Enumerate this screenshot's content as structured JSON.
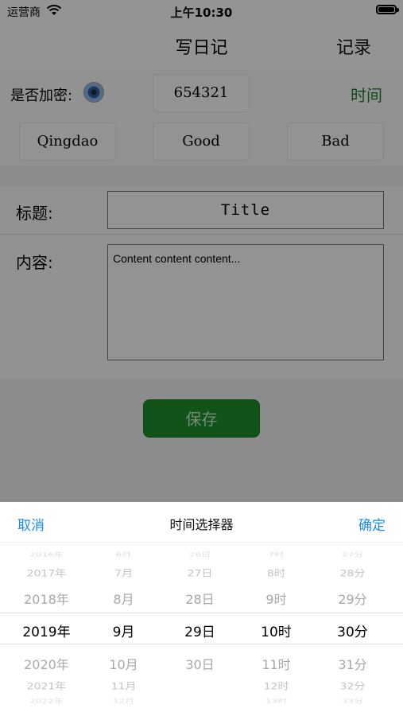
{
  "status": {
    "carrier": "运营商",
    "time": "上午10:30"
  },
  "nav": {
    "title": "写日记",
    "right_button": "记录"
  },
  "form": {
    "encrypt_label": "是否加密:",
    "password_value": "654321",
    "time_button": "时间",
    "options": [
      "Qingdao",
      "Good",
      "Bad"
    ],
    "title_label": "标题:",
    "title_value": "Title",
    "content_label": "内容:",
    "content_value": "Content content content...",
    "save_button": "保存"
  },
  "picker": {
    "cancel": "取消",
    "title": "时间选择器",
    "confirm": "确定",
    "columns": [
      {
        "name": "year",
        "above_far": "2016年",
        "above2": "2017年",
        "above1": "2018年",
        "selected": "2019年",
        "below1": "2020年",
        "below2": "2021年",
        "below_far": "2022年"
      },
      {
        "name": "month",
        "above_far": "6月",
        "above2": "7月",
        "above1": "8月",
        "selected": "9月",
        "below1": "10月",
        "below2": "11月",
        "below_far": "12月"
      },
      {
        "name": "day",
        "above_far": "26日",
        "above2": "27日",
        "above1": "28日",
        "selected": "29日",
        "below1": "30日",
        "below2": "",
        "below_far": ""
      },
      {
        "name": "hour",
        "above_far": "7时",
        "above2": "8时",
        "above1": "9时",
        "selected": "10时",
        "below1": "11时",
        "below2": "12时",
        "below_far": "13时"
      },
      {
        "name": "minute",
        "above_far": "27分",
        "above2": "28分",
        "above1": "29分",
        "selected": "30分",
        "below1": "31分",
        "below2": "32分",
        "below_far": "33分"
      }
    ]
  },
  "colors": {
    "accent_blue": "#1a8cf0",
    "green": "#1f8a2c",
    "time_green": "#1f7a2d"
  },
  "icons": {
    "wifi": "wifi-icon",
    "battery": "battery-icon",
    "radio": "radio-button-icon"
  }
}
